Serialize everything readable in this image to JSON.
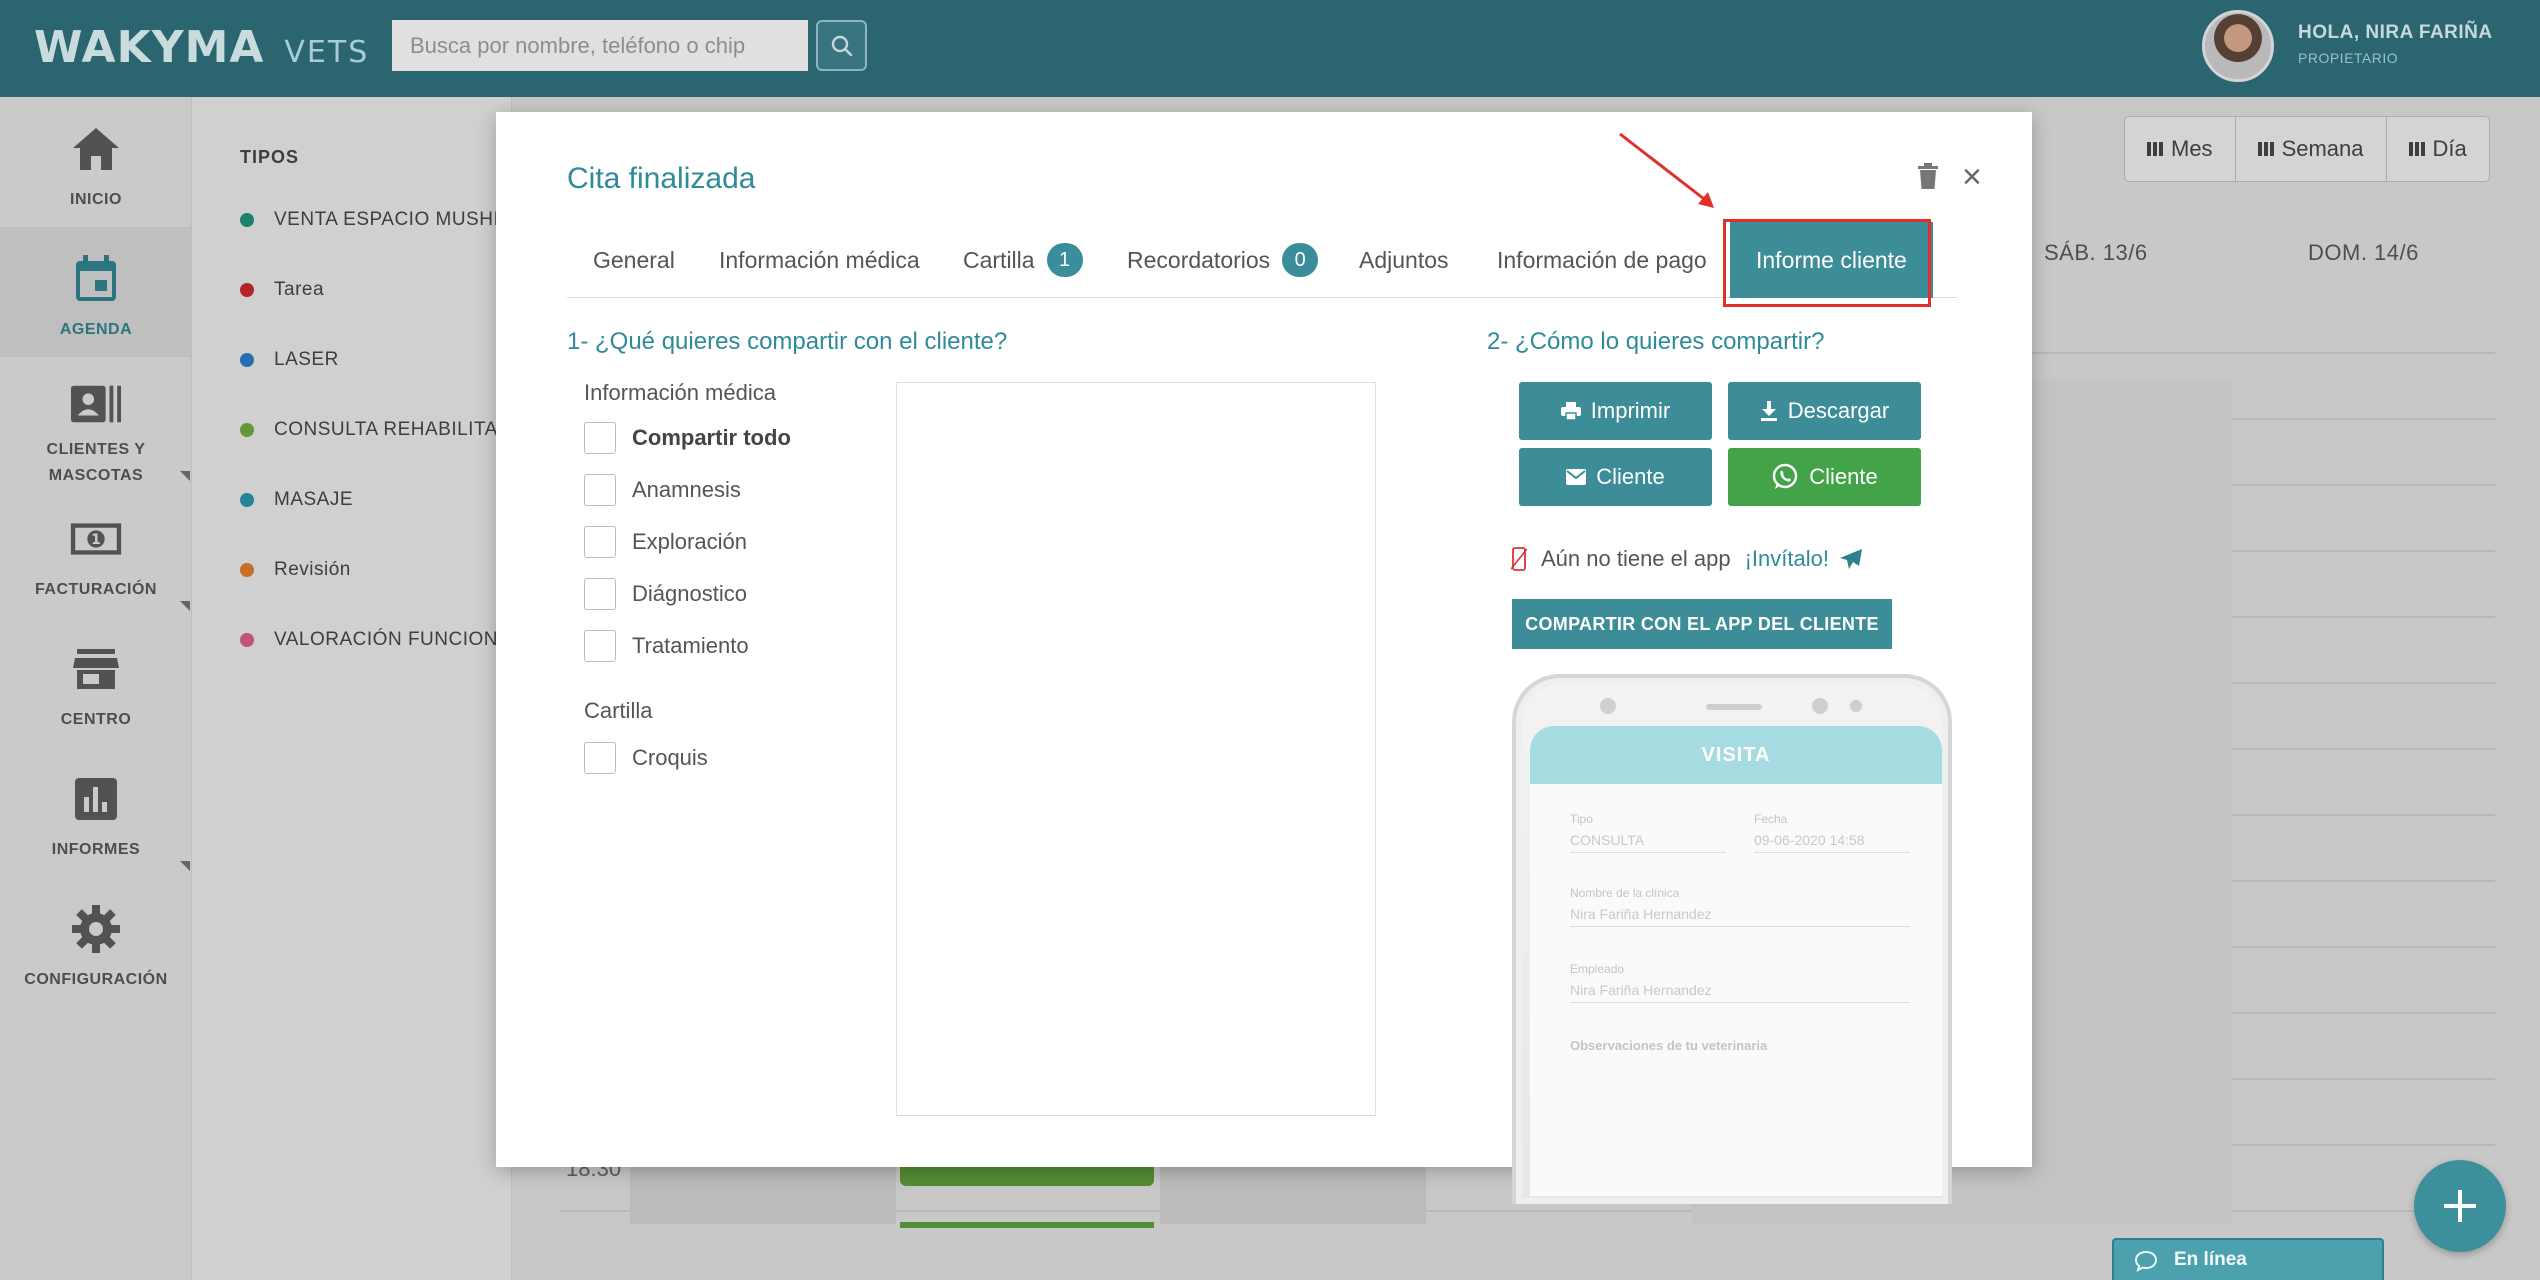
{
  "topbar": {
    "logo_main": "WAKYMA",
    "logo_sub": "VETS",
    "search_placeholder": "Busca por nombre, teléfono o chip",
    "user_greeting": "HOLA, NIRA FARIÑA",
    "user_role": "PROPIETARIO"
  },
  "nav": {
    "items": [
      {
        "label": "INICIO",
        "icon": "home-icon"
      },
      {
        "label": "AGENDA",
        "icon": "calendar-icon"
      },
      {
        "label": "CLIENTES Y\nMASCOTAS",
        "icon": "contacts-icon"
      },
      {
        "label": "FACTURACIÓN",
        "icon": "money-icon"
      },
      {
        "label": "CENTRO",
        "icon": "store-icon"
      },
      {
        "label": "INFORMES",
        "icon": "chart-icon"
      },
      {
        "label": "CONFIGURACIÓN",
        "icon": "gear-icon"
      }
    ]
  },
  "types": {
    "title": "TIPOS",
    "items": [
      {
        "label": "VENTA ESPACIO MUSHI",
        "color": "#1f8a7a"
      },
      {
        "label": "Tarea",
        "color": "#c0282d"
      },
      {
        "label": "LASER",
        "color": "#2a78c2"
      },
      {
        "label": "CONSULTA REHABILITAC",
        "color": "#6fa43a"
      },
      {
        "label": "MASAJE",
        "color": "#2a8fa8"
      },
      {
        "label": "Revisión",
        "color": "#d9782a"
      },
      {
        "label": "VALORACIÓN FUNCIONA",
        "color": "#d25c84"
      }
    ]
  },
  "calendar": {
    "views": [
      "Mes",
      "Semana",
      "Día"
    ],
    "day_headers": [
      "SÁB. 13/6",
      "DOM. 14/6"
    ],
    "time_label": "18:30"
  },
  "chat": {
    "label": "En línea"
  },
  "modal": {
    "title": "Cita finalizada",
    "tabs": [
      {
        "label": "General"
      },
      {
        "label": "Información médica"
      },
      {
        "label": "Cartilla",
        "badge": "1"
      },
      {
        "label": "Recordatorios",
        "badge": "0"
      },
      {
        "label": "Adjuntos"
      },
      {
        "label": "Información de pago"
      },
      {
        "label": "Informe cliente"
      }
    ],
    "section1_title": "1- ¿Qué quieres compartir con el cliente?",
    "section2_title": "2- ¿Cómo lo quieres compartir?",
    "medical_group": "Información médica",
    "medical_options": [
      "Compartir todo",
      "Anamnesis",
      "Exploración",
      "Diágnostico",
      "Tratamiento"
    ],
    "cartilla_group": "Cartilla",
    "cartilla_options": [
      "Croquis"
    ],
    "share": {
      "print": "Imprimir",
      "download": "Descargar",
      "email": "Cliente",
      "whatsapp": "Cliente"
    },
    "invite_text": "Aún no tiene el app",
    "invite_link": "¡Invítalo!",
    "app_share_button": "COMPARTIR CON EL APP DEL CLIENTE",
    "phone": {
      "header": "VISITA",
      "tipo_label": "Tipo",
      "tipo_value": "CONSULTA",
      "fecha_label": "Fecha",
      "fecha_value": "09-06-2020 14:58",
      "clinic_label": "Nombre de la clínica",
      "clinic_value": "Nira Fariña Hernandez",
      "employee_label": "Empleado",
      "employee_value": "Nira Fariña Hernandez",
      "observations_label": "Observaciones de tu veterinaria"
    }
  },
  "colors": {
    "topbar": "#2f6e7a",
    "accent": "#3d8d99",
    "whatsapp": "#43a348",
    "highlight": "#e0302c"
  }
}
